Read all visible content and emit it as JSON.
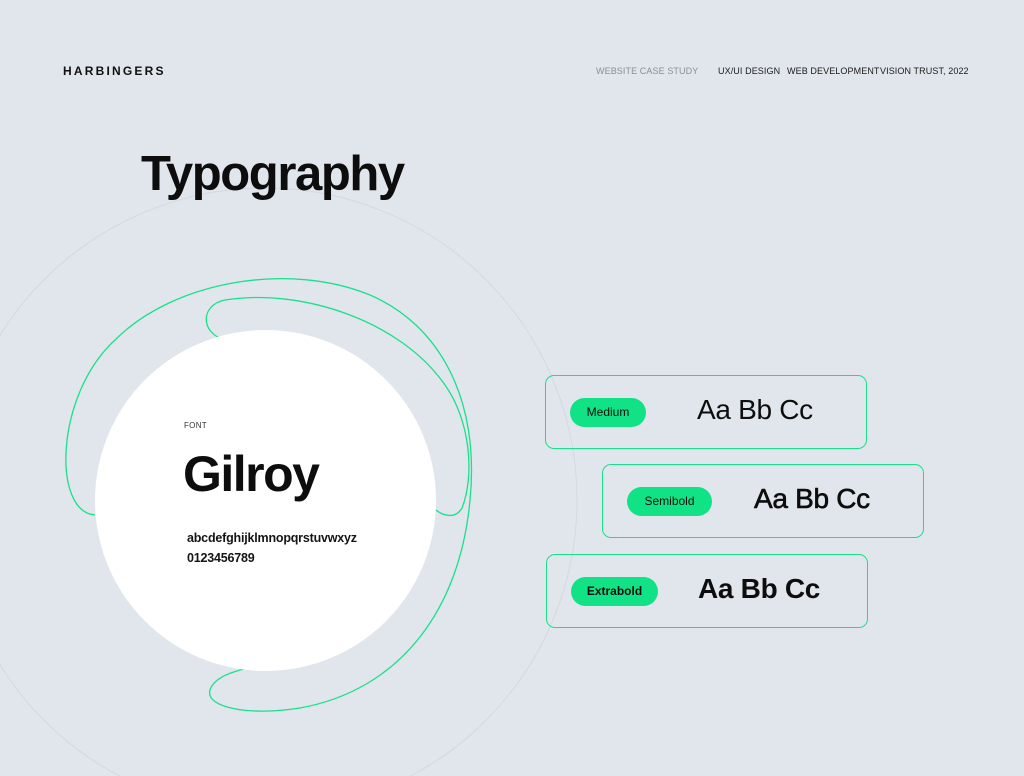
{
  "header": {
    "brand": "HARBINGERS",
    "nav": {
      "case_study": "WEBSITE CASE STUDY",
      "ux_ui": "UX/UI DESIGN",
      "web_dev": "WEB DEVELOPMENT",
      "client_year": "VISION TRUST, 2022"
    }
  },
  "section": {
    "title": "Typography"
  },
  "font_specimen": {
    "label": "FONT",
    "name": "Gilroy",
    "alphabet": "abcdefghijklmnopqrstuvwxyz",
    "digits": "0123456789"
  },
  "weights": [
    {
      "name": "Medium",
      "sample": "Aa Bb Cc"
    },
    {
      "name": "Semibold",
      "sample": "Aa Bb Cc"
    },
    {
      "name": "Extrabold",
      "sample": "Aa Bb Cc"
    }
  ],
  "colors": {
    "background": "#e1e6ec",
    "accent": "#11e286",
    "text": "#0d0d0d"
  }
}
